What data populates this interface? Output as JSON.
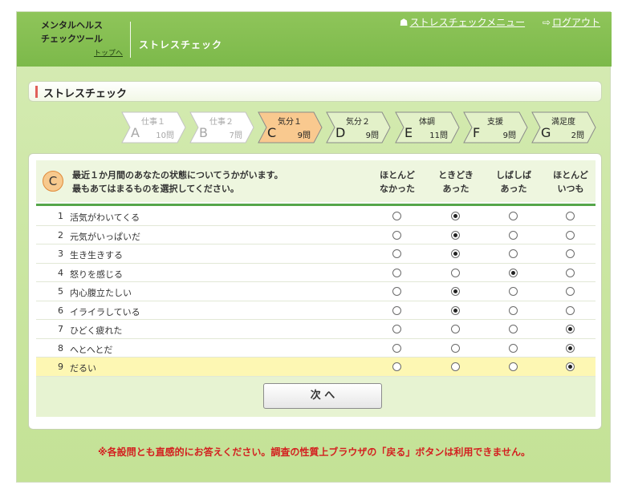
{
  "header": {
    "logo_line1": "メンタルヘルス",
    "logo_line2": "チェックツール",
    "top_link": "トップへ",
    "title": "ストレスチェック",
    "nav": [
      {
        "label": "ストレスチェックメニュー",
        "icon": "home-icon"
      },
      {
        "label": "ログアウト",
        "icon": "logout-icon"
      }
    ]
  },
  "section_title": "ストレスチェック",
  "steps": [
    {
      "name": "仕事１",
      "letter": "A",
      "count": "10問",
      "state": "done"
    },
    {
      "name": "仕事２",
      "letter": "B",
      "count": "7問",
      "state": "done"
    },
    {
      "name": "気分１",
      "letter": "C",
      "count": "9問",
      "state": "current"
    },
    {
      "name": "気分２",
      "letter": "D",
      "count": "9問",
      "state": "todo"
    },
    {
      "name": "体調",
      "letter": "E",
      "count": "11問",
      "state": "todo"
    },
    {
      "name": "支援",
      "letter": "F",
      "count": "9問",
      "state": "todo"
    },
    {
      "name": "満足度",
      "letter": "G",
      "count": "2問",
      "state": "todo"
    }
  ],
  "question": {
    "badge": "C",
    "line1": "最近１か月間のあなたの状態についてうかがいます。",
    "line2": "最もあてはまるものを選択してください。"
  },
  "choices": [
    {
      "line1": "ほとんど",
      "line2": "なかった"
    },
    {
      "line1": "ときどき",
      "line2": "あった"
    },
    {
      "line1": "しばしば",
      "line2": "あった"
    },
    {
      "line1": "ほとんど",
      "line2": "いつも"
    }
  ],
  "items": [
    {
      "num": "1",
      "label": "活気がわいてくる",
      "selected": 1
    },
    {
      "num": "2",
      "label": "元気がいっぱいだ",
      "selected": 1
    },
    {
      "num": "3",
      "label": "生き生きする",
      "selected": 1
    },
    {
      "num": "4",
      "label": "怒りを感じる",
      "selected": 2
    },
    {
      "num": "5",
      "label": "内心腹立たしい",
      "selected": 1
    },
    {
      "num": "6",
      "label": "イライラしている",
      "selected": 1
    },
    {
      "num": "7",
      "label": "ひどく疲れた",
      "selected": 3
    },
    {
      "num": "8",
      "label": "へとへとだ",
      "selected": 3
    },
    {
      "num": "9",
      "label": "だるい",
      "selected": 3,
      "highlight": true
    }
  ],
  "next_button": "次 へ",
  "notice": "※各設問とも直感的にお答えください。調査の性質上ブラウザの「戻る」ボタンは利用できません。",
  "colors": {
    "header_green": "#7cb94a",
    "current_step": "#f9c98f",
    "notice_red": "#d32020",
    "highlight_row": "#fdf7b3"
  }
}
